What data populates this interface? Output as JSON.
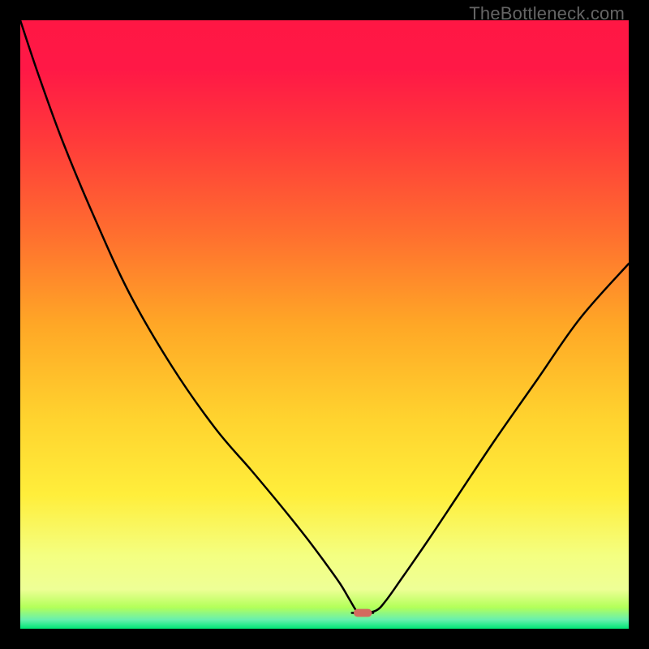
{
  "watermark": "TheBottleneck.com",
  "chart_data": {
    "type": "line",
    "title": "",
    "xlabel": "",
    "ylabel": "",
    "xlim": [
      0,
      100
    ],
    "ylim": [
      0,
      100
    ],
    "gradient_stops": [
      {
        "offset": 0.0,
        "color": "#ff1744"
      },
      {
        "offset": 0.08,
        "color": "#ff1846"
      },
      {
        "offset": 0.2,
        "color": "#ff3b3a"
      },
      {
        "offset": 0.35,
        "color": "#ff6e2f"
      },
      {
        "offset": 0.5,
        "color": "#ffa726"
      },
      {
        "offset": 0.65,
        "color": "#ffd22e"
      },
      {
        "offset": 0.78,
        "color": "#ffee3b"
      },
      {
        "offset": 0.88,
        "color": "#f4ff81"
      },
      {
        "offset": 0.935,
        "color": "#eeff96"
      },
      {
        "offset": 0.965,
        "color": "#b2ff59"
      },
      {
        "offset": 0.985,
        "color": "#69f0ae"
      },
      {
        "offset": 1.0,
        "color": "#00e676"
      }
    ],
    "series": [
      {
        "name": "curve",
        "x": [
          0.0,
          3.0,
          7.0,
          12.0,
          18.0,
          25.0,
          32.0,
          38.0,
          43.0,
          47.0,
          50.0,
          52.5,
          54.0,
          55.0,
          55.5,
          56.5,
          58.5,
          60.0,
          62.5,
          67.0,
          72.0,
          78.0,
          85.0,
          92.0,
          100.0
        ],
        "y": [
          100.0,
          91.0,
          80.0,
          68.0,
          55.0,
          43.0,
          33.0,
          26.0,
          20.0,
          15.0,
          11.0,
          7.5,
          5.0,
          3.3,
          2.6,
          2.6,
          3.0,
          4.5,
          8.0,
          14.5,
          22.0,
          31.0,
          41.0,
          51.0,
          60.0
        ]
      }
    ],
    "flat_segment": {
      "x0": 54.5,
      "x1": 58.0,
      "y": 2.6
    },
    "marker": {
      "x": 56.3,
      "y": 2.6,
      "width": 3.0,
      "height": 1.3,
      "color": "#d46a5f"
    }
  }
}
